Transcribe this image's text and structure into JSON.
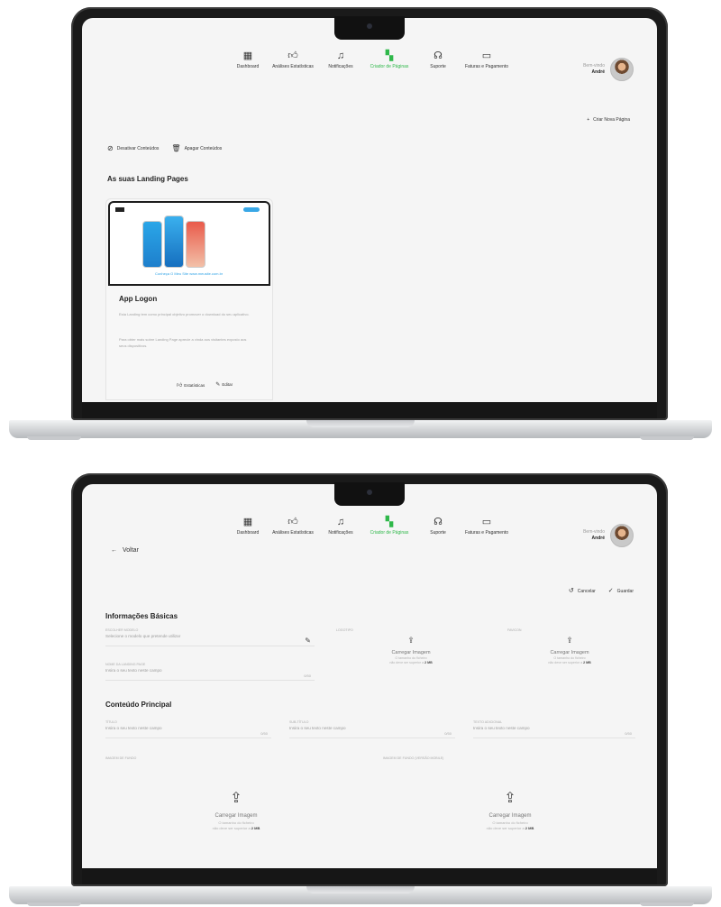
{
  "nav": [
    {
      "label": "Dashboard",
      "icon": "grid-icon"
    },
    {
      "label": "Análises Estatísticas",
      "icon": "thumbs-up-icon"
    },
    {
      "label": "Notificações",
      "icon": "bell-icon"
    },
    {
      "label": "Criador de Páginas",
      "icon": "pages-icon",
      "active": true
    },
    {
      "label": "Suporte",
      "icon": "headset-icon"
    },
    {
      "label": "Faturas e Pagamento",
      "icon": "card-icon"
    }
  ],
  "user": {
    "greeting": "Bem-vindo",
    "name": "André"
  },
  "colors": {
    "accent": "#2fb84a",
    "link": "#2fa2e6"
  },
  "screen1": {
    "create_label": "Criar Nova Página",
    "actions": [
      "Desativar Conteúdos",
      "Apagar Conteúdos"
    ],
    "section_title": "As suas Landing Pages",
    "card": {
      "cta": "Conheça O Meu Site www.meusite.com.br",
      "title": "App Logon",
      "desc1": "Esta Landing tem como principal objetivo promover o download do seu aplicativo.",
      "desc2": "Para obter mais sobre Landing Page aprecie a vinda aos visitantes exposto aos seus dispositivos.",
      "stats_label": "Estatísticas",
      "edit_label": "Editar"
    }
  },
  "screen2": {
    "back_label": "Voltar",
    "cancel_label": "Cancelar",
    "save_label": "Guardar",
    "basic_title": "Informações Básicas",
    "field_url": {
      "label": "ESCOLHER MODELO",
      "value": "Selecione o modelo que pretende utilizar"
    },
    "field_name": {
      "label": "NOME DA LANDING PAGE",
      "value": "Insira o seu texto neste campo",
      "count": "0/50"
    },
    "logo": {
      "label": "LOGOTIPO",
      "title": "Carregar Imagem",
      "sub": "O tamanho do ficheiro",
      "max": "não deve ser superior a",
      "max_value": "2 MB"
    },
    "favicon": {
      "label": "FAVICON",
      "title": "Carregar Imagem",
      "sub": "O tamanho do ficheiro",
      "max": "não deve ser superior a",
      "max_value": "2 MB"
    },
    "main_title": "Conteúdo Principal",
    "field_title": {
      "label": "TÍTULO",
      "value": "Insira o seu texto neste campo",
      "count": "0/50"
    },
    "field_subtitle": {
      "label": "SUB-TÍTULO",
      "value": "Insira o seu texto neste campo",
      "count": "0/50"
    },
    "field_extra": {
      "label": "TEXTO ADICIONAL",
      "value": "Insira o seu texto neste campo",
      "count": "0/50"
    },
    "image_main": {
      "label": "IMAGEM DE FUNDO",
      "title": "Carregar Imagem",
      "sub": "O tamanho do ficheiro",
      "max": "não deve ser superior a",
      "max_value": "2 MB"
    },
    "image_second": {
      "label": "IMAGEM DE FUNDO (VERSÃO MOBILE)",
      "title": "Carregar Imagem",
      "sub": "O tamanho do ficheiro",
      "max": "não deve ser superior a",
      "max_value": "2 MB"
    }
  }
}
